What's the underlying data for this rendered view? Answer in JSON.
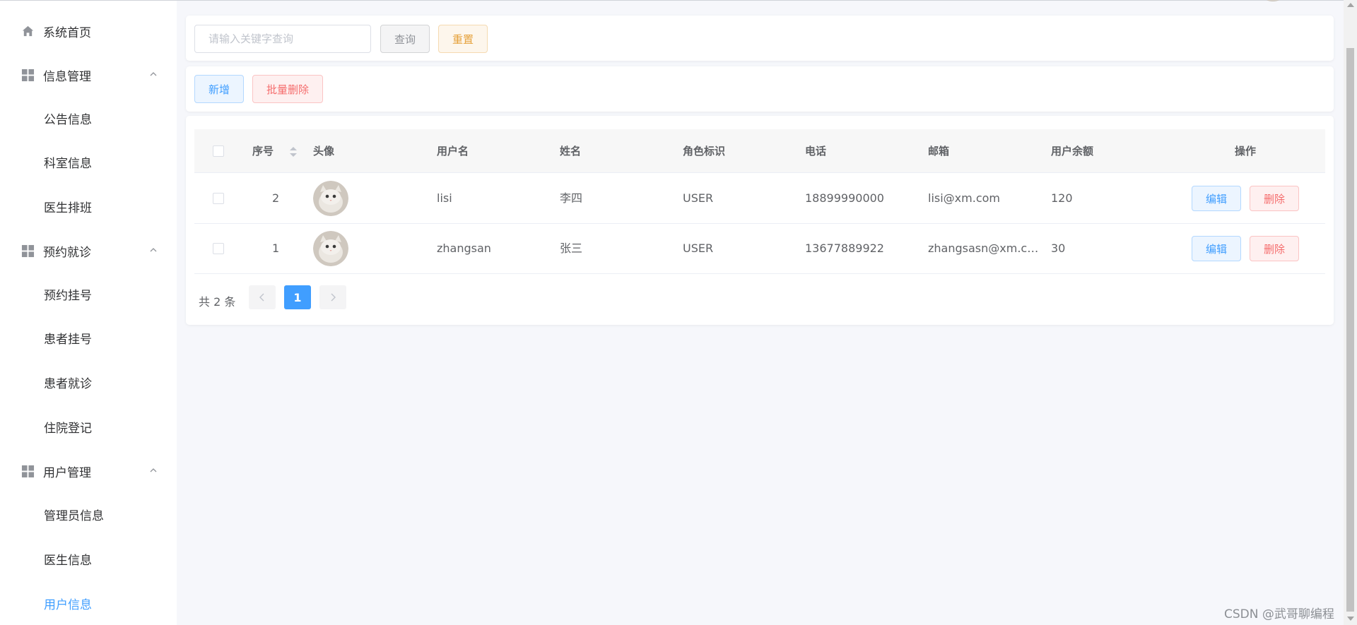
{
  "sidebar": {
    "items": [
      {
        "label": "系统首页",
        "icon": "home-icon",
        "type": "top"
      },
      {
        "label": "信息管理",
        "icon": "grid-icon",
        "type": "group"
      },
      {
        "label": "公告信息",
        "type": "sub"
      },
      {
        "label": "科室信息",
        "type": "sub"
      },
      {
        "label": "医生排班",
        "type": "sub"
      },
      {
        "label": "预约就诊",
        "icon": "grid-icon",
        "type": "group"
      },
      {
        "label": "预约挂号",
        "type": "sub"
      },
      {
        "label": "患者挂号",
        "type": "sub"
      },
      {
        "label": "患者就诊",
        "type": "sub"
      },
      {
        "label": "住院登记",
        "type": "sub"
      },
      {
        "label": "用户管理",
        "icon": "grid-icon",
        "type": "group"
      },
      {
        "label": "管理员信息",
        "type": "sub"
      },
      {
        "label": "医生信息",
        "type": "sub"
      },
      {
        "label": "用户信息",
        "type": "sub",
        "active": true
      }
    ]
  },
  "search": {
    "placeholder": "请输入关键字查询",
    "query_label": "查询",
    "reset_label": "重置"
  },
  "toolbar": {
    "add_label": "新增",
    "batch_delete_label": "批量删除"
  },
  "table": {
    "columns": [
      "序号",
      "头像",
      "用户名",
      "姓名",
      "角色标识",
      "电话",
      "邮箱",
      "用户余额",
      "操作"
    ],
    "rows": [
      {
        "id": "2",
        "username": "lisi",
        "name": "李四",
        "role": "USER",
        "phone": "18899990000",
        "email": "lisi@xm.com",
        "balance": "120"
      },
      {
        "id": "1",
        "username": "zhangsan",
        "name": "张三",
        "role": "USER",
        "phone": "13677889922",
        "email": "zhangsasn@xm.co...",
        "balance": "30"
      }
    ],
    "edit_label": "编辑",
    "delete_label": "删除"
  },
  "pagination": {
    "total_label": "共 2 条",
    "current_page": "1"
  },
  "watermark": "CSDN @武哥聊编程",
  "colors": {
    "primary": "#409eff",
    "danger": "#f56c6c",
    "warning": "#e6a23c",
    "info": "#909399"
  }
}
